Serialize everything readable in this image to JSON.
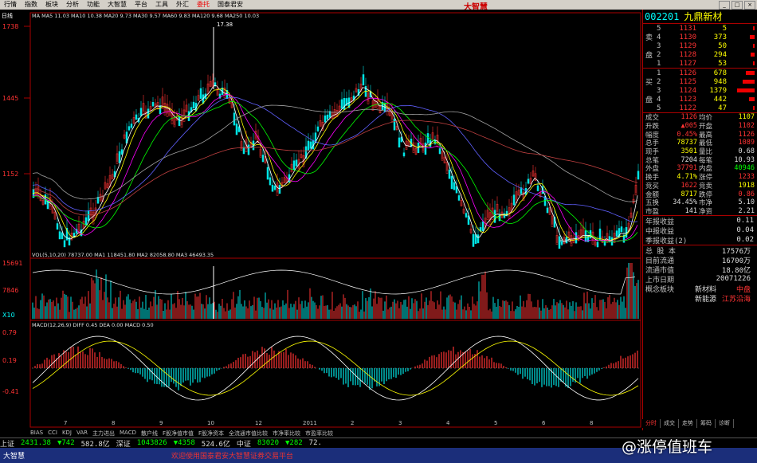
{
  "menu": [
    "行情",
    "指数",
    "板块",
    "分析",
    "功能",
    "大智慧",
    "平台",
    "工具",
    "外汇",
    "委托",
    "国泰君安"
  ],
  "menu_active": "委托",
  "logo_text": "大智慧",
  "chart": {
    "period_label": "日线",
    "ma_header": "MA MA5 11.03 MA10 10.38 MA20 9.73 MA30 9.57 MA60 9.83 MA120 9.68 MA250 10.03",
    "y_labels": [
      "1738",
      "1445",
      "1152"
    ],
    "peak_label": "17.38",
    "low_label": "8.64",
    "vol_header": "VOL(5,10,20)  78737.00  MA1 118451.80  MA2 82058.80  MA3 46493.35",
    "vol_labels": [
      "15691",
      "7846",
      "X10"
    ],
    "macd_header": "MACD(12,26,9)  DIFF 0.45  DEA 0.00  MACD 0.50",
    "macd_labels": [
      "0.79",
      "0.19",
      "-0.41"
    ],
    "x_labels": [
      "7",
      "8",
      "9",
      "10",
      "12",
      "2011",
      "2",
      "3",
      "4",
      "5",
      "6",
      "8"
    ]
  },
  "indicator_tabs": [
    "BIAS",
    "CCI",
    "KDJ",
    "VAR",
    "主力进出",
    "MACD",
    "散户线",
    "F股净值市值",
    "F股净资本",
    "全流通市值比较",
    "市净率比较",
    "市盈率比较"
  ],
  "stock": {
    "code": "002201",
    "name": "九鼎新材"
  },
  "order_book": {
    "sell": [
      {
        "side": "",
        "lvl": "5",
        "price": "1131",
        "vol": "5"
      },
      {
        "side": "卖",
        "lvl": "4",
        "price": "1130",
        "vol": "373"
      },
      {
        "side": "",
        "lvl": "3",
        "price": "1129",
        "vol": "50"
      },
      {
        "side": "盘",
        "lvl": "2",
        "price": "1128",
        "vol": "294"
      },
      {
        "side": "",
        "lvl": "1",
        "price": "1127",
        "vol": "53"
      }
    ],
    "buy": [
      {
        "side": "",
        "lvl": "1",
        "price": "1126",
        "vol": "678"
      },
      {
        "side": "买",
        "lvl": "2",
        "price": "1125",
        "vol": "948"
      },
      {
        "side": "",
        "lvl": "3",
        "price": "1124",
        "vol": "1379"
      },
      {
        "side": "盘",
        "lvl": "4",
        "price": "1123",
        "vol": "442"
      },
      {
        "side": "",
        "lvl": "5",
        "price": "1122",
        "vol": "47"
      }
    ]
  },
  "stats": [
    {
      "a": "成交",
      "b": "1126",
      "c": "均价",
      "d": "1107"
    },
    {
      "a": "升跌",
      "b": "▲005",
      "c": "开盘",
      "d": "1102"
    },
    {
      "a": "幅度",
      "b": "0.45%",
      "c": "最高",
      "d": "1126"
    },
    {
      "a": "总手",
      "b": "78737",
      "c": "最低",
      "d": "1089"
    },
    {
      "a": "现手",
      "b": "3501",
      "c": "量比",
      "d": "0.68"
    },
    {
      "a": "总笔",
      "b": "7204",
      "c": "每笔",
      "d": "10.93"
    },
    {
      "a": "外盘",
      "b": "37791",
      "c": "内盘",
      "d": "40946"
    },
    {
      "a": "换手",
      "b": "4.71%",
      "c": "涨停",
      "d": "1233"
    },
    {
      "a": "竞买",
      "b": "1622",
      "c": "竞卖",
      "d": "1918"
    },
    {
      "a": "金额",
      "b": "8717",
      "c": "跌停",
      "d": "0.86"
    },
    {
      "a": "五换",
      "b": "34.45%",
      "c": "市净",
      "d": "5.10"
    },
    {
      "a": "市盈",
      "b": "141",
      "c": "净资",
      "d": "2.21"
    }
  ],
  "finance": [
    {
      "k": "年报收益",
      "v": "0.11"
    },
    {
      "k": "中报收益",
      "v": "0.04"
    },
    {
      "k": "季报收益(2)",
      "v": "0.02"
    }
  ],
  "info": [
    {
      "k": "总 股 本",
      "v": "17576万"
    },
    {
      "k": "目前流通",
      "v": "16700万"
    },
    {
      "k": "流通市值",
      "v": "18.80亿"
    },
    {
      "k": "上市日期",
      "v": "20071226"
    },
    {
      "k": "概念板块",
      "v": "新材料",
      "v2": "中盘"
    },
    {
      "k": "",
      "v": "新能源",
      "v2": "江苏沿海"
    }
  ],
  "right_tabs": [
    "分时",
    "成交",
    "走势",
    "筹码",
    "诊断"
  ],
  "ticker": [
    {
      "label": "上证",
      "value": "2431.38",
      "cls": "grn"
    },
    {
      "label": "",
      "value": "▼742",
      "cls": "grn"
    },
    {
      "label": "",
      "value": "582.8亿",
      "cls": "wht"
    },
    {
      "label": "深证",
      "value": "1043826",
      "cls": "grn"
    },
    {
      "label": "",
      "value": "▼4358",
      "cls": "grn"
    },
    {
      "label": "",
      "value": "524.6亿",
      "cls": "wht"
    },
    {
      "label": "中证",
      "value": "83020",
      "cls": "grn"
    },
    {
      "label": "",
      "value": "▼282",
      "cls": "grn"
    },
    {
      "label": "",
      "value": "72.",
      "cls": "wht"
    }
  ],
  "status": {
    "brand": "大智慧",
    "welcome": "欢迎使用国泰君安大智慧证券交易平台"
  },
  "watermark": "@涨停值班车",
  "colors": {
    "up": "#ff3333",
    "down": "#00e5e5",
    "ma5": "#ffffff",
    "ma10": "#ffff00",
    "ma20": "#ff00ff",
    "ma30": "#00ff00",
    "ma60": "#6060ff",
    "border": "#aa0000"
  }
}
